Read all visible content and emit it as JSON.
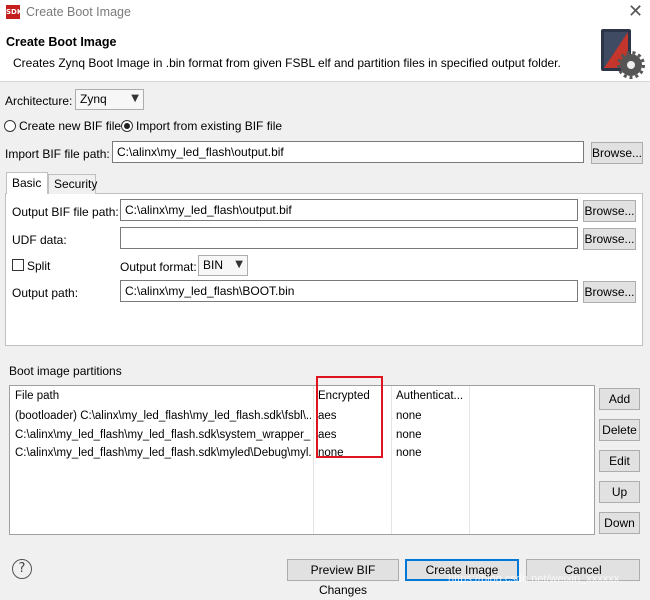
{
  "window": {
    "app_icon": "SDK",
    "title": "Create Boot Image",
    "close_icon": "✕"
  },
  "header": {
    "title": "Create Boot Image",
    "description": "Creates Zynq Boot Image in .bin format from given FSBL elf and partition files in specified output folder."
  },
  "architecture": {
    "label": "Architecture:",
    "value": "Zynq"
  },
  "bif_mode": {
    "create_new_label": "Create new BIF file",
    "import_existing_label": "Import from existing BIF file",
    "selected": "import_existing"
  },
  "import_bif": {
    "label": "Import BIF file path:",
    "value": "C:\\alinx\\my_led_flash\\output.bif",
    "browse_label": "Browse..."
  },
  "tabs": [
    {
      "label": "Basic",
      "active": true
    },
    {
      "label": "Security",
      "active": false
    }
  ],
  "basic": {
    "output_bif_label": "Output BIF file path:",
    "output_bif_value": "C:\\alinx\\my_led_flash\\output.bif",
    "udf_label": "UDF data:",
    "udf_value": "",
    "split_label": "Split",
    "split_checked": false,
    "output_format_label": "Output format:",
    "output_format_value": "BIN",
    "output_path_label": "Output path:",
    "output_path_value": "C:\\alinx\\my_led_flash\\BOOT.bin",
    "browse_label": "Browse..."
  },
  "partitions": {
    "section_label": "Boot image partitions",
    "columns": [
      "File path",
      "Encrypted",
      "Authenticat..."
    ],
    "rows": [
      {
        "path": "(bootloader) C:\\alinx\\my_led_flash\\my_led_flash.sdk\\fsbl\\...",
        "encrypted": "aes",
        "auth": "none"
      },
      {
        "path": "C:\\alinx\\my_led_flash\\my_led_flash.sdk\\system_wrapper_h...",
        "encrypted": "aes",
        "auth": "none"
      },
      {
        "path": "C:\\alinx\\my_led_flash\\my_led_flash.sdk\\myled\\Debug\\myl...",
        "encrypted": "none",
        "auth": "none"
      }
    ],
    "buttons": {
      "add": "Add",
      "delete": "Delete",
      "edit": "Edit",
      "up": "Up",
      "down": "Down"
    }
  },
  "footer": {
    "help_icon": "?",
    "preview_label": "Preview BIF Changes",
    "create_label": "Create Image",
    "cancel_label": "Cancel",
    "watermark": "https://blog.csdn.net/weixin_xxxxxx"
  },
  "colors": {
    "highlight_box": "#e0141e",
    "primary_button_border": "#0078d7"
  }
}
